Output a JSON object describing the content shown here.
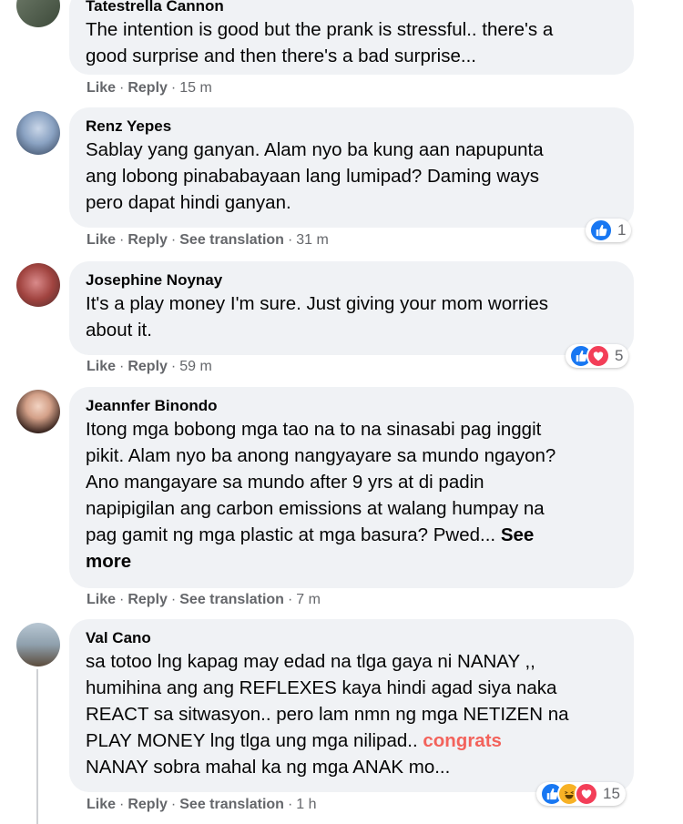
{
  "comments": [
    {
      "author": "Tatestrella Cannon",
      "lines": [
        "The intention is good but the prank is stressful.. there's a",
        "good surprise and then there's a bad surprise..."
      ],
      "actions": {
        "like": "Like",
        "reply": "Reply",
        "time": "15 m"
      }
    },
    {
      "author": "Renz Yepes",
      "lines": [
        "Sablay yang ganyan. Alam nyo ba kung aan napupunta",
        "ang lobong pinababayaan lang lumipad? Daming ways",
        "pero dapat hindi ganyan."
      ],
      "actions": {
        "like": "Like",
        "reply": "Reply",
        "translate": "See translation",
        "time": "31 m"
      },
      "reactions": {
        "icons": [
          "like-icon"
        ],
        "count": "1"
      }
    },
    {
      "author": "Josephine Noynay",
      "lines": [
        "It's a play money I'm sure. Just giving your mom worries",
        "about it."
      ],
      "actions": {
        "like": "Like",
        "reply": "Reply",
        "time": "59 m"
      },
      "reactions": {
        "icons": [
          "like-icon",
          "love-icon"
        ],
        "count": "5"
      }
    },
    {
      "author": "Jeannfer Binondo",
      "lines": [
        "Itong mga bobong mga tao na to na sinasabi pag inggit",
        "pikit. Alam nyo ba anong nangyayare sa mundo ngayon?",
        "Ano mangayare sa mundo after 9 yrs at di padin",
        "napipigilan ang carbon emissions at walang humpay na",
        "pag gamit ng mga plastic at mga basura? Pwed..."
      ],
      "see_more_1": "See",
      "see_more_2": "more",
      "actions": {
        "like": "Like",
        "reply": "Reply",
        "translate": "See translation",
        "time": "7 m"
      }
    },
    {
      "author": "Val Cano",
      "lines": [
        "sa totoo lng kapag may edad na tlga gaya ni NANAY ,,",
        "humihina ang ang REFLEXES kaya hindi agad siya naka",
        "REACT sa sitwasyon.. pero lam nmn ng mga NETIZEN na",
        "PLAY MONEY lng tlga ung mga nilipad..",
        "NANAY sobra mahal ka ng mga ANAK mo..."
      ],
      "highlight": "congrats",
      "actions": {
        "like": "Like",
        "reply": "Reply",
        "translate": "See translation",
        "time": "1 h"
      },
      "reactions": {
        "icons": [
          "like-icon",
          "haha-icon",
          "love-icon"
        ],
        "count": "15"
      }
    }
  ],
  "actions_separator": "·",
  "colors": {
    "bubble": "#f0f2f5",
    "meta_text": "#65676b",
    "like_blue": "#1877f2",
    "love_red": "#f33e58",
    "haha_yellow": "#f7b125",
    "highlight": "#f3625b"
  }
}
